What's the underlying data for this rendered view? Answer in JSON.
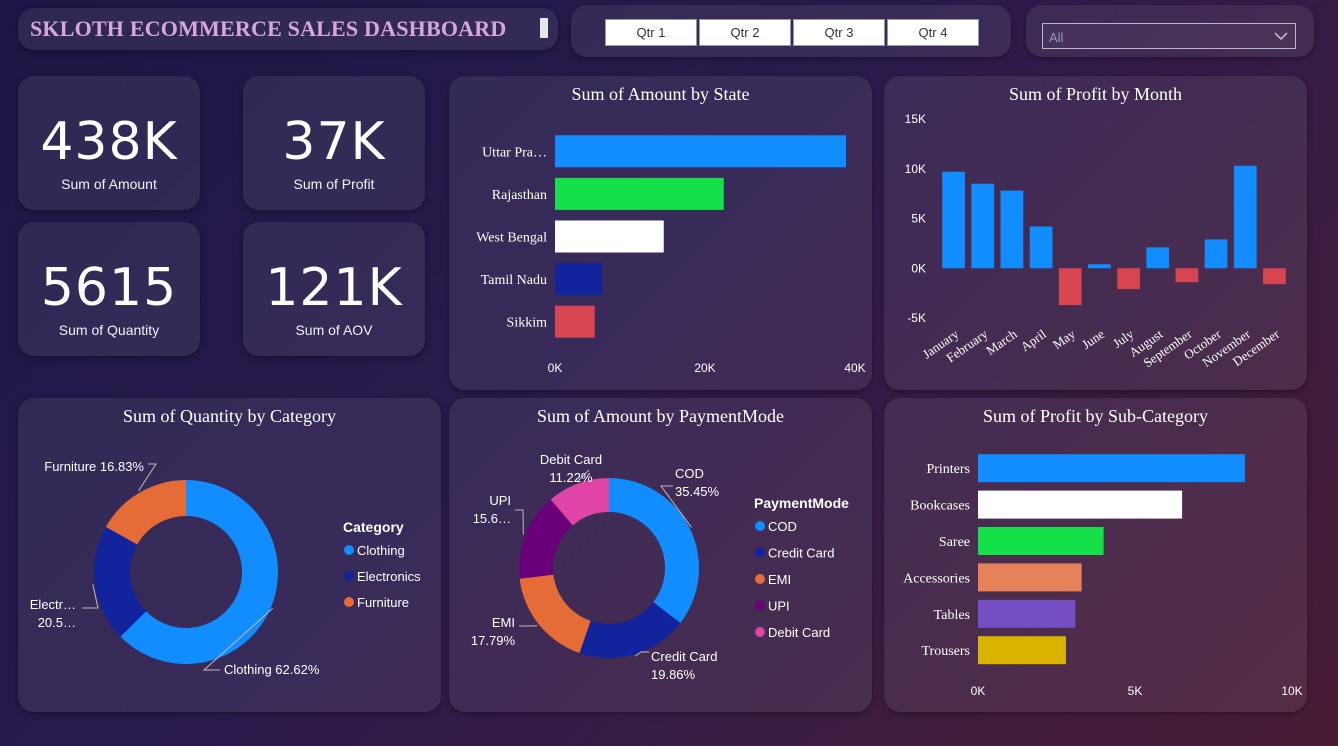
{
  "header": {
    "title": "SKLOTH ECOMMERCE SALES DASHBOARD"
  },
  "quarters": [
    "Qtr 1",
    "Qtr 2",
    "Qtr 3",
    "Qtr 4"
  ],
  "filter": {
    "value": "All"
  },
  "kpis": [
    {
      "value": "438K",
      "label": "Sum of Amount"
    },
    {
      "value": "37K",
      "label": "Sum of Profit"
    },
    {
      "value": "5615",
      "label": "Sum of Quantity"
    },
    {
      "value": "121K",
      "label": "Sum of AOV"
    }
  ],
  "chart_data": [
    {
      "id": "amount_by_state",
      "type": "bar",
      "orientation": "horizontal",
      "title": "Sum of Amount by State",
      "categories": [
        "Uttar Pra…",
        "Rajasthan",
        "West Bengal",
        "Tamil Nadu",
        "Sikkim"
      ],
      "values": [
        38800,
        22500,
        14500,
        6300,
        5300
      ],
      "colors": [
        "#118dff",
        "#15e04a",
        "#ffffff",
        "#12239e",
        "#d64550"
      ],
      "xlim": [
        0,
        40000
      ],
      "xticks": [
        0,
        20000,
        40000
      ],
      "xtick_labels": [
        "0K",
        "20K",
        "40K"
      ],
      "grid": false
    },
    {
      "id": "profit_by_month",
      "type": "bar",
      "title": "Sum of Profit by Month",
      "categories": [
        "January",
        "February",
        "March",
        "April",
        "May",
        "June",
        "July",
        "August",
        "September",
        "October",
        "November",
        "December"
      ],
      "values": [
        9700,
        8500,
        7800,
        4200,
        -3700,
        400,
        -2100,
        2100,
        -1400,
        2900,
        10300,
        -1600
      ],
      "positive_color": "#118dff",
      "negative_color": "#d64550",
      "ylim": [
        -5000,
        15000
      ],
      "yticks": [
        -5000,
        0,
        5000,
        10000,
        15000
      ],
      "ytick_labels": [
        "-5K",
        "0K",
        "5K",
        "10K",
        "15K"
      ],
      "grid": false
    },
    {
      "id": "quantity_by_category",
      "type": "pie",
      "donut": true,
      "title": "Sum of Quantity by Category",
      "legend_title": "Category",
      "legend_position": "right",
      "slices": [
        {
          "name": "Clothing",
          "value": 62.62,
          "color": "#118dff",
          "label": "Clothing 62.62%"
        },
        {
          "name": "Electronics",
          "value": 20.55,
          "color": "#12239e",
          "label_line1": "Electr…",
          "label_line2": "20.5…"
        },
        {
          "name": "Furniture",
          "value": 16.83,
          "color": "#e66c37",
          "label": "Furniture 16.83%"
        }
      ]
    },
    {
      "id": "amount_by_paymentmode",
      "type": "pie",
      "donut": true,
      "title": "Sum of Amount by PaymentMode",
      "legend_title": "PaymentMode",
      "legend_position": "right",
      "slices": [
        {
          "name": "COD",
          "value": 35.45,
          "color": "#118dff",
          "label_line1": "COD",
          "label_line2": "35.45%"
        },
        {
          "name": "Credit Card",
          "value": 19.86,
          "color": "#12239e",
          "label_line1": "Credit Card",
          "label_line2": "19.86%"
        },
        {
          "name": "EMI",
          "value": 17.79,
          "color": "#e66c37",
          "label_line1": "EMI",
          "label_line2": "17.79%"
        },
        {
          "name": "UPI",
          "value": 15.68,
          "color": "#6b007b",
          "label_line1": "UPI",
          "label_line2": "15.6…"
        },
        {
          "name": "Debit Card",
          "value": 11.22,
          "color": "#e044a7",
          "label_line1": "Debit Card",
          "label_line2": "11.22%"
        }
      ]
    },
    {
      "id": "profit_by_subcategory",
      "type": "bar",
      "orientation": "horizontal",
      "title": "Sum of Profit by Sub-Category",
      "categories": [
        "Printers",
        "Bookcases",
        "Saree",
        "Accessories",
        "Tables",
        "Trousers"
      ],
      "values": [
        8500,
        6500,
        4000,
        3300,
        3100,
        2800
      ],
      "colors": [
        "#118dff",
        "#ffffff",
        "#15e04a",
        "#e8825a",
        "#744ec2",
        "#d9b300"
      ],
      "xlim": [
        0,
        10000
      ],
      "xticks": [
        0,
        5000,
        10000
      ],
      "xtick_labels": [
        "0K",
        "5K",
        "10K"
      ],
      "grid": false
    }
  ]
}
